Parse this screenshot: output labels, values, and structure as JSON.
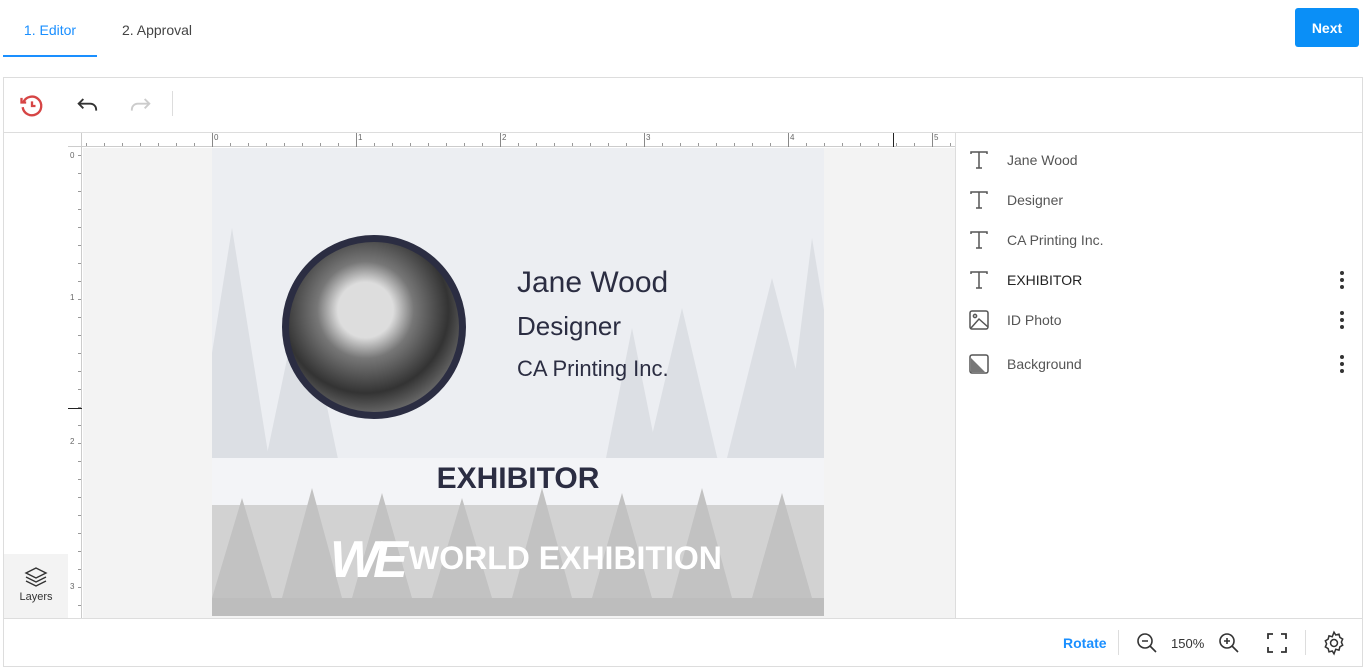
{
  "tabs": [
    {
      "label": "1. Editor",
      "active": true
    },
    {
      "label": "2. Approval",
      "active": false
    }
  ],
  "next_label": "Next",
  "toolbar": {
    "history_icon": "history-icon",
    "undo_icon": "undo-icon",
    "redo_icon": "redo-icon"
  },
  "layers_button": {
    "label": "Layers"
  },
  "ruler": {
    "top_labels": [
      "0",
      "1",
      "2",
      "3",
      "4",
      "5"
    ],
    "left_labels": [
      "0",
      "1",
      "2",
      "3"
    ]
  },
  "badge": {
    "name": "Jane Wood",
    "title": "Designer",
    "company": "CA Printing Inc.",
    "role": "EXHIBITOR",
    "logo": "WE",
    "event": "WORLD EXHIBITION"
  },
  "layers": [
    {
      "label": "Jane Wood",
      "icon": "text-icon",
      "menu": false
    },
    {
      "label": "Designer",
      "icon": "text-icon",
      "menu": false
    },
    {
      "label": "CA Printing Inc.",
      "icon": "text-icon",
      "menu": false
    },
    {
      "label": "EXHIBITOR",
      "icon": "text-icon",
      "menu": true
    },
    {
      "label": "ID Photo",
      "icon": "image-icon",
      "menu": true
    },
    {
      "label": "Background",
      "icon": "background-icon",
      "menu": true
    }
  ],
  "bottom": {
    "rotate_label": "Rotate",
    "zoom": "150%"
  },
  "colors": {
    "accent": "#0a8ff7",
    "history": "#d64545",
    "badge_text": "#2b2d42"
  }
}
